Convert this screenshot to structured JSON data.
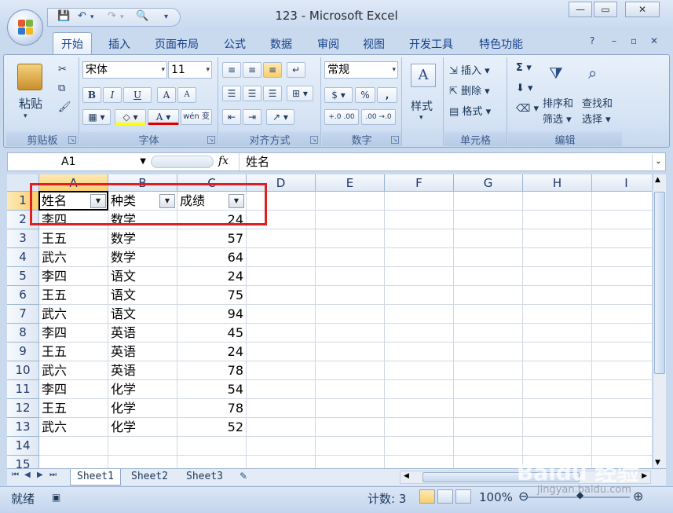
{
  "window": {
    "title": "123 - Microsoft Excel",
    "minimize": "—",
    "maximize": "▭",
    "close": "✕"
  },
  "qat": {
    "save": "💾",
    "undo": "↶",
    "undo_dd": "▾",
    "redo": "↷",
    "redo_dd": "▾",
    "preview": "🔍",
    "customize": "▾"
  },
  "ribbon_tabs": [
    "开始",
    "插入",
    "页面布局",
    "公式",
    "数据",
    "审阅",
    "视图",
    "开发工具",
    "特色功能"
  ],
  "ribbon_right_icons": [
    "?",
    "–",
    "▫",
    "✕"
  ],
  "clipboard": {
    "paste": "粘贴",
    "label": "剪贴板"
  },
  "font": {
    "name": "宋体",
    "size": "11",
    "bold": "B",
    "italic": "I",
    "underline": "U",
    "grow": "A",
    "shrink": "A",
    "wen": "wén 变",
    "label": "字体"
  },
  "alignment": {
    "label": "对齐方式"
  },
  "number": {
    "format": "常规",
    "percent": "%",
    "comma": ",",
    "inc": "+.0 .00",
    "dec": ".00 →.0",
    "label": "数字"
  },
  "styles": {
    "label": "样式"
  },
  "cells": {
    "insert": "插入",
    "delete": "删除",
    "format": "格式",
    "label": "单元格"
  },
  "editing": {
    "sum": "Σ",
    "sort": "排序和",
    "sort2": "筛选",
    "find": "查找和",
    "find2": "选择",
    "label": "编辑"
  },
  "formula_bar": {
    "name_box": "A1",
    "fx": "fx",
    "value": "姓名"
  },
  "columns": [
    "A",
    "B",
    "C",
    "D",
    "E",
    "F",
    "G",
    "H",
    "I"
  ],
  "rows": [
    "1",
    "2",
    "3",
    "4",
    "5",
    "6",
    "7",
    "8",
    "9",
    "10",
    "11",
    "12",
    "13",
    "14",
    "15"
  ],
  "header_row": [
    "姓名",
    "种类",
    "成绩"
  ],
  "data": [
    [
      "李四",
      "数学",
      "24"
    ],
    [
      "王五",
      "数学",
      "57"
    ],
    [
      "武六",
      "数学",
      "64"
    ],
    [
      "李四",
      "语文",
      "24"
    ],
    [
      "王五",
      "语文",
      "75"
    ],
    [
      "武六",
      "语文",
      "94"
    ],
    [
      "李四",
      "英语",
      "45"
    ],
    [
      "王五",
      "英语",
      "24"
    ],
    [
      "武六",
      "英语",
      "78"
    ],
    [
      "李四",
      "化学",
      "54"
    ],
    [
      "王五",
      "化学",
      "78"
    ],
    [
      "武六",
      "化学",
      "52"
    ]
  ],
  "sheets": [
    "Sheet1",
    "Sheet2",
    "Sheet3"
  ],
  "status": {
    "mode": "就绪",
    "count": "计数: 3",
    "zoom": "100%"
  },
  "watermark": {
    "brand": "Baidu 经验",
    "url": "jingyan.baidu.com"
  },
  "colors": {
    "highlight": "#e02020",
    "accent": "#15428b"
  }
}
